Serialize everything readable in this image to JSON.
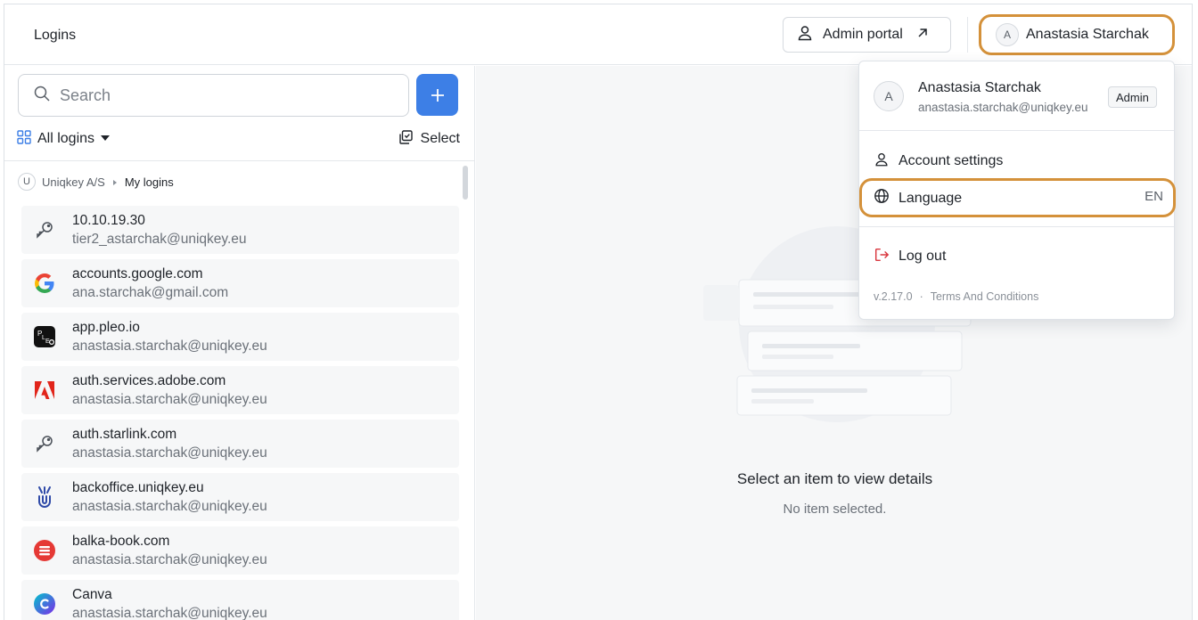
{
  "header": {
    "title": "Logins",
    "admin_portal_label": "Admin portal",
    "user_name": "Anastasia Starchak",
    "user_initial": "A"
  },
  "search": {
    "placeholder": "Search"
  },
  "filters": {
    "all_logins_label": "All logins",
    "select_label": "Select"
  },
  "breadcrumb": {
    "org_initial": "U",
    "org": "Uniqkey A/S",
    "folder": "My logins"
  },
  "logins": [
    {
      "host": "10.10.19.30",
      "user": "tier2_astarchak@uniqkey.eu",
      "icon": "key-icon"
    },
    {
      "host": "accounts.google.com",
      "user": "ana.starchak@gmail.com",
      "icon": "google-icon"
    },
    {
      "host": "app.pleo.io",
      "user": "anastasia.starchak@uniqkey.eu",
      "icon": "pleo-icon"
    },
    {
      "host": "auth.services.adobe.com",
      "user": "anastasia.starchak@uniqkey.eu",
      "icon": "adobe-icon"
    },
    {
      "host": "auth.starlink.com",
      "user": "anastasia.starchak@uniqkey.eu",
      "icon": "key-icon"
    },
    {
      "host": "backoffice.uniqkey.eu",
      "user": "anastasia.starchak@uniqkey.eu",
      "icon": "uniqkey-icon"
    },
    {
      "host": "balka-book.com",
      "user": "anastasia.starchak@uniqkey.eu",
      "icon": "balka-icon"
    },
    {
      "host": "Canva",
      "user": "anastasia.starchak@uniqkey.eu",
      "icon": "canva-icon"
    }
  ],
  "detail": {
    "empty_title": "Select an item to view details",
    "empty_subtitle": "No item selected."
  },
  "user_menu": {
    "initial": "A",
    "name": "Anastasia Starchak",
    "email": "anastasia.starchak@uniqkey.eu",
    "role": "Admin",
    "account_settings": "Account settings",
    "language_label": "Language",
    "language_value": "EN",
    "logout": "Log out",
    "version": "v.2.17.0",
    "separator": "·",
    "terms": "Terms And Conditions"
  },
  "colors": {
    "accent": "#3d7fe6",
    "highlight": "#d4913a",
    "logout": "#d9363e"
  }
}
